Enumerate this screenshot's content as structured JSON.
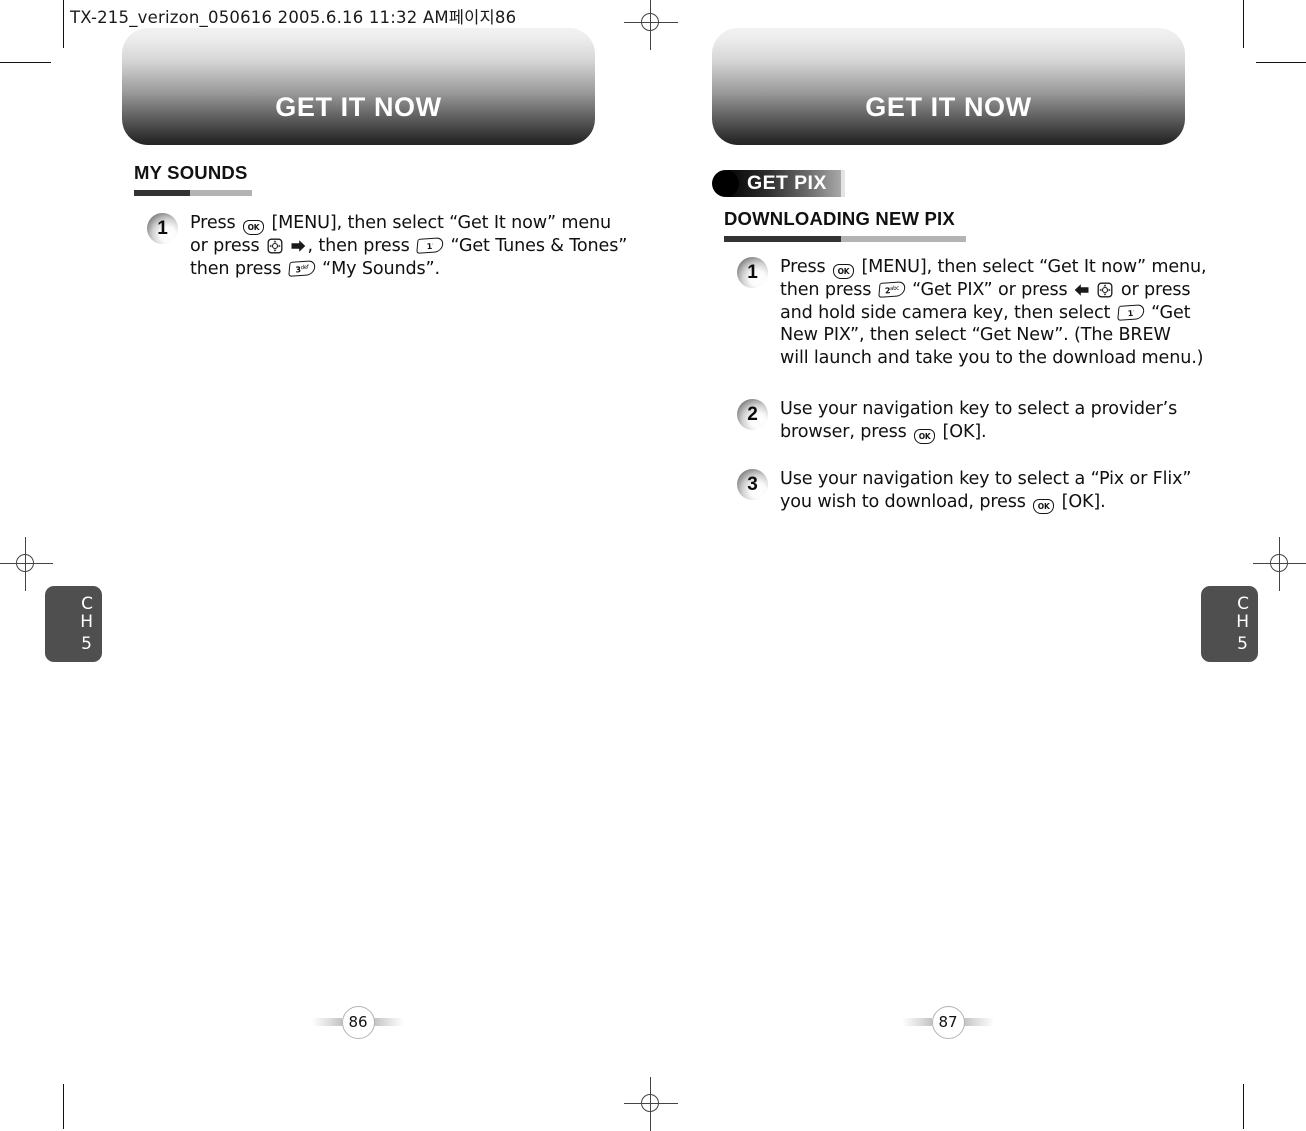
{
  "file_header": "TX-215_verizon_050616  2005.6.16 11:32 AM페이지86",
  "pages": {
    "left": {
      "banner_title": "GET IT NOW",
      "section": {
        "title": "MY SOUNDS"
      },
      "steps": [
        {
          "number": "1",
          "lines": [
            "Press [ok] [MENU], then select “Get It now” menu",
            "or press [nav] →, then press [1] “Get Tunes & Tones”",
            "then press [3] “My Sounds”."
          ]
        }
      ],
      "chapter_tab": {
        "c": "C",
        "h": "H",
        "number": "5"
      },
      "page_number": "86"
    },
    "right": {
      "banner_title": "GET IT NOW",
      "tag": {
        "label": "GET PIX"
      },
      "section": {
        "title": "DOWNLOADING NEW PIX"
      },
      "steps": [
        {
          "number": "1",
          "lines": [
            "Press [ok] [MENU], then select “Get It now” menu,",
            "then press [2] “Get PIX” or press ← [nav] or press",
            "and hold side camera key, then select [1] “Get",
            "New PIX”, then select “Get New”. (The BREW",
            "will launch and take you to the download menu.)"
          ]
        },
        {
          "number": "2",
          "lines": [
            "Use your navigation key to select a provider’s",
            "browser, press [ok] [OK]."
          ]
        },
        {
          "number": "3",
          "lines": [
            "Use your navigation key to select a “Pix or Flix”",
            "you wish to download, press [ok] [OK]."
          ]
        }
      ],
      "chapter_tab": {
        "c": "C",
        "h": "H",
        "number": "5"
      },
      "page_number": "87"
    }
  },
  "key_glyphs": {
    "ok": "OK",
    "one": "1",
    "one_sub": "·",
    "two": "2",
    "two_sub": "abc",
    "three": "3",
    "three_sub": "def"
  },
  "colors": {
    "banner_top": "#f2f2f2",
    "banner_bottom": "#242424",
    "rule_dark": "#333333",
    "rule_light": "#b3b3b3",
    "chapter_tab_bg": "#4f4f4f",
    "text": "#111111"
  }
}
